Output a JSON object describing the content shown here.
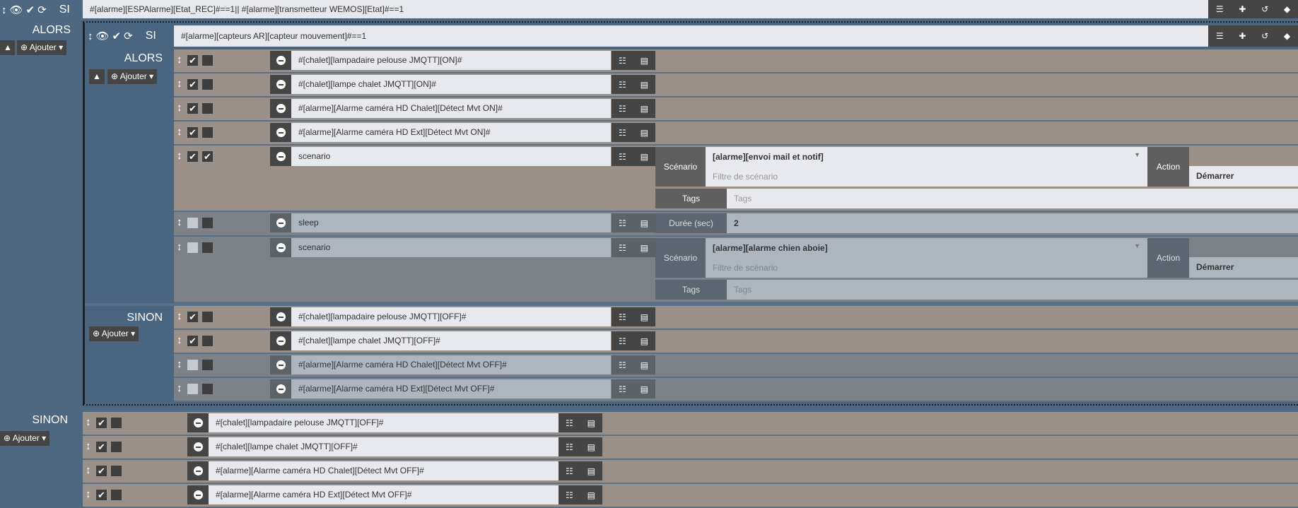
{
  "top": {
    "si_label": "SI",
    "condition": "#[alarme][ESPAlarme][Etat_REC]#==1|| #[alarme][transmetteur WEMOS][Etat]#==1",
    "alors_label": "ALORS",
    "ajouter_label": "Ajouter",
    "sinon_label": "SINON"
  },
  "nested": {
    "si_label": "SI",
    "condition": "#[alarme][capteurs AR][capteur mouvement]#==1",
    "alors_label": "ALORS",
    "ajouter_label": "Ajouter",
    "sinon_label": "SINON"
  },
  "panel_labels": {
    "scenario": "Scénario",
    "action": "Action",
    "tags": "Tags",
    "duration": "Durée (sec)",
    "filter_placeholder": "Filtre de scénario",
    "tags_placeholder": "Tags"
  },
  "nested_alors": [
    {
      "type": "cmd",
      "enabled": true,
      "option": false,
      "command": "#[chalet][lampadaire pelouse JMQTT][ON]#"
    },
    {
      "type": "cmd",
      "enabled": true,
      "option": false,
      "command": "#[chalet][lampe chalet JMQTT][ON]#"
    },
    {
      "type": "cmd",
      "enabled": true,
      "option": false,
      "command": "#[alarme][Alarme caméra HD Chalet][Détect Mvt ON]#"
    },
    {
      "type": "cmd",
      "enabled": true,
      "option": false,
      "command": "#[alarme][Alarme caméra HD Ext][Détect Mvt ON]#"
    },
    {
      "type": "scenario",
      "enabled": true,
      "option": true,
      "command": "scenario",
      "scenario": "[alarme][envoi mail et notif]",
      "action": "Démarrer"
    },
    {
      "type": "sleep",
      "enabled": false,
      "option": false,
      "command": "sleep",
      "duration": "2"
    },
    {
      "type": "scenario",
      "enabled": false,
      "option": false,
      "command": "scenario",
      "scenario": "[alarme][alarme chien aboie]",
      "action": "Démarrer"
    }
  ],
  "nested_sinon": [
    {
      "type": "cmd",
      "enabled": true,
      "option": false,
      "command": "#[chalet][lampadaire pelouse JMQTT][OFF]#"
    },
    {
      "type": "cmd",
      "enabled": true,
      "option": false,
      "command": "#[chalet][lampe chalet JMQTT][OFF]#"
    },
    {
      "type": "cmd",
      "enabled": false,
      "option": false,
      "command": "#[alarme][Alarme caméra HD Chalet][Détect Mvt OFF]#"
    },
    {
      "type": "cmd",
      "enabled": false,
      "option": false,
      "command": "#[alarme][Alarme caméra HD Ext][Détect Mvt OFF]#"
    }
  ],
  "outer_sinon": [
    {
      "type": "cmd",
      "enabled": true,
      "option": false,
      "command": "#[chalet][lampadaire pelouse JMQTT][OFF]#"
    },
    {
      "type": "cmd",
      "enabled": true,
      "option": false,
      "command": "#[chalet][lampe chalet JMQTT][OFF]#"
    },
    {
      "type": "cmd",
      "enabled": true,
      "option": false,
      "command": "#[alarme][Alarme caméra HD Chalet][Détect Mvt OFF]#"
    },
    {
      "type": "cmd",
      "enabled": true,
      "option": false,
      "command": "#[alarme][Alarme caméra HD Ext][Détect Mvt OFF]#"
    }
  ]
}
